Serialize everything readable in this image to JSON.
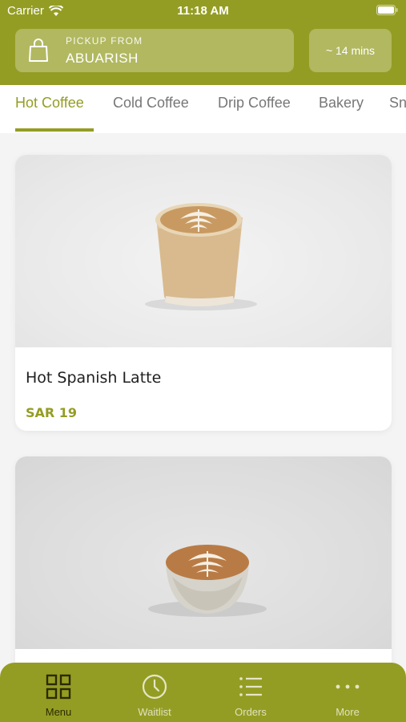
{
  "status_bar": {
    "carrier": "Carrier",
    "time": "11:18 AM"
  },
  "header": {
    "pickup_label": "PICKUP FROM",
    "pickup_location": "ABUARISH",
    "eta": "~ 14 mins"
  },
  "tabs": [
    {
      "label": "Hot Coffee",
      "active": true
    },
    {
      "label": "Cold Coffee",
      "active": false
    },
    {
      "label": "Drip Coffee",
      "active": false
    },
    {
      "label": "Bakery",
      "active": false
    },
    {
      "label": "Sn",
      "active": false
    }
  ],
  "products": [
    {
      "name": "Hot Spanish Latte",
      "price": "SAR 19"
    },
    {
      "name": "",
      "price": ""
    }
  ],
  "bottom_nav": [
    {
      "label": "Menu",
      "icon": "grid-icon",
      "active": true
    },
    {
      "label": "Waitlist",
      "icon": "clock-icon",
      "active": false
    },
    {
      "label": "Orders",
      "icon": "list-icon",
      "active": false
    },
    {
      "label": "More",
      "icon": "more-dots-icon",
      "active": false
    }
  ],
  "colors": {
    "brand_green": "#949d23",
    "dark_active": "#2b2b00"
  }
}
